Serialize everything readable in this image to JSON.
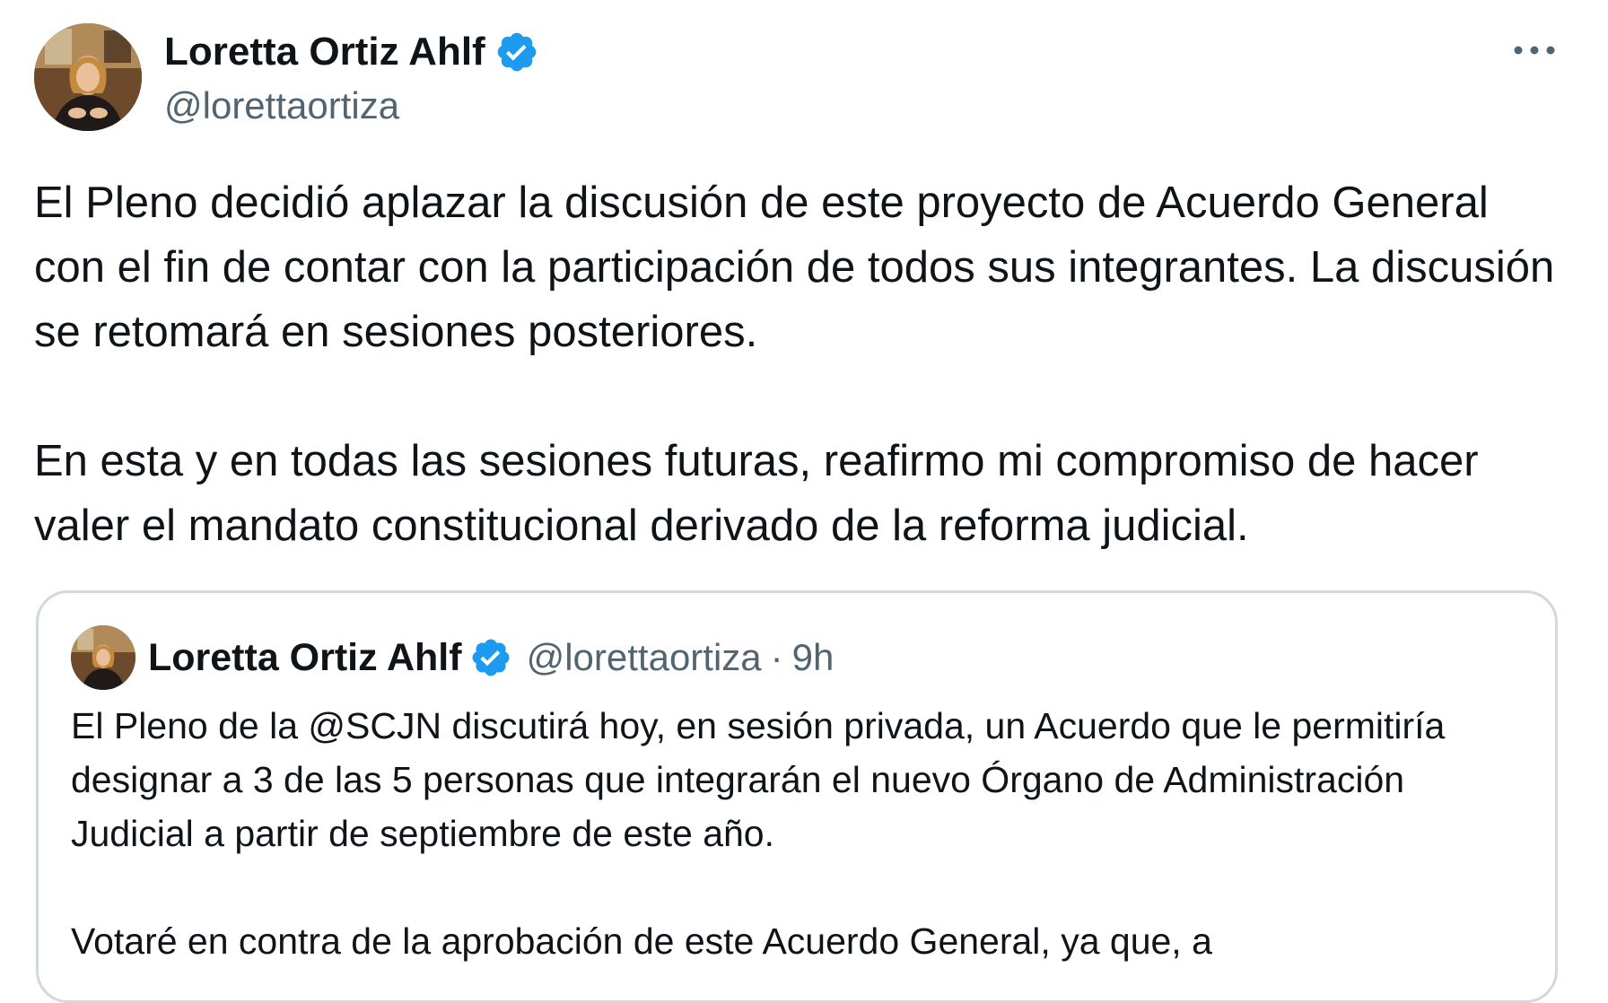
{
  "tweet": {
    "author": {
      "name": "Loretta Ortiz Ahlf",
      "handle": "@lorettaortiza"
    },
    "text_paragraphs": [
      "El Pleno decidió aplazar la discusión de este proyecto de Acuerdo General con el fin de contar con la participación de todos sus integrantes. La discusión se retomará en sesiones posteriores.",
      "En esta y en todas las sesiones futuras, reafirmo mi compromiso de hacer valer el mandato constitucional derivado de la reforma judicial."
    ],
    "icons": {
      "verified": "verified-badge-icon",
      "more": "more-options-icon"
    },
    "colors": {
      "verified": "#1d9bf0",
      "text": "#0f1419",
      "secondary": "#536471",
      "border": "#cfd9de"
    }
  },
  "quoted_tweet": {
    "author": {
      "name": "Loretta Ortiz Ahlf",
      "handle": "@lorettaortiza"
    },
    "separator": "·",
    "time": "9h",
    "text_paragraphs": [
      "El Pleno de la @SCJN discutirá hoy, en sesión privada, un Acuerdo que le permitiría designar a 3 de las 5 personas que integrarán el nuevo Órgano de Administración Judicial a partir de septiembre de este año.",
      "Votaré en contra de la aprobación de este Acuerdo General, ya que, a"
    ]
  }
}
